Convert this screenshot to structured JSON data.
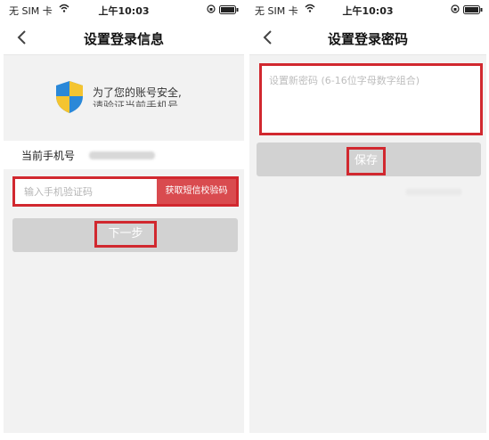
{
  "status_bar": {
    "carrier": "无 SIM 卡",
    "time": "上午10:03"
  },
  "screen_login_info": {
    "title": "设置登录信息",
    "banner_text": "为了您的账号安全,",
    "banner_text_2": "请验证当前手机号",
    "phone_label": "当前手机号",
    "code_placeholder": "输入手机验证码",
    "sms_button": "获取短信校验码",
    "next_button": "下一步"
  },
  "screen_password": {
    "title": "设置登录密码",
    "password_placeholder": "设置新密码 (6-16位字母数字组合)",
    "save_button": "保存"
  },
  "colors": {
    "highlight": "#d1282f",
    "sms_button_bg": "#d94b4f",
    "disabled_button": "#d2d2d2",
    "page_bg": "#f2f2f2"
  },
  "icons": [
    "wifi-icon",
    "lock-rotation-icon",
    "battery-icon",
    "back-chevron-icon",
    "shield-icon"
  ]
}
